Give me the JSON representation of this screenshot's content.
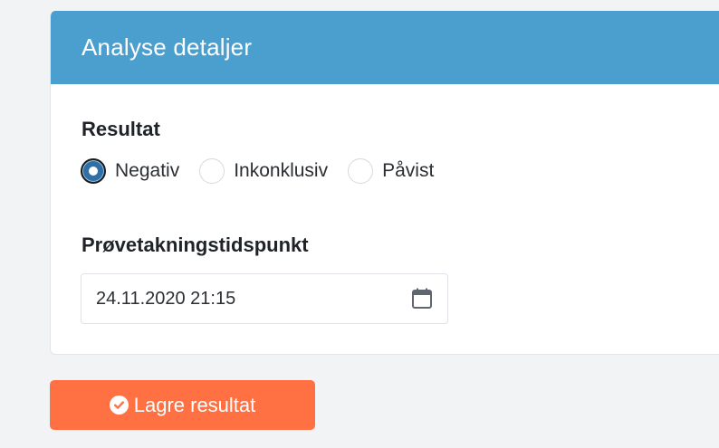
{
  "card": {
    "title": "Analyse detaljer"
  },
  "result": {
    "label": "Resultat",
    "options": [
      {
        "label": "Negativ",
        "checked": true
      },
      {
        "label": "Inkonklusiv",
        "checked": false
      },
      {
        "label": "Påvist",
        "checked": false
      }
    ]
  },
  "sampling": {
    "label": "Prøvetakningstidspunkt",
    "value": "24.11.2020 21:15",
    "icon": "calendar-icon"
  },
  "actions": {
    "save_label": "Lagre resultat",
    "save_icon": "check-circle-icon"
  },
  "colors": {
    "header": "#4a9fce",
    "button": "#ff7043",
    "radio_checked": "#2f6fa6"
  }
}
